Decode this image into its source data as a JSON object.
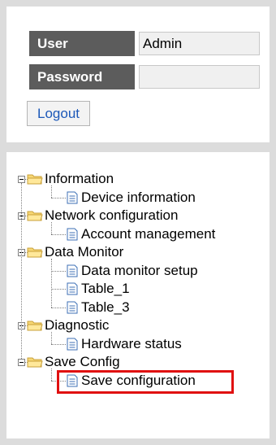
{
  "login": {
    "user_label": "User",
    "user_value": "Admin",
    "password_label": "Password",
    "password_value": "",
    "logout_label": "Logout"
  },
  "tree": {
    "groups": [
      {
        "label": "Information",
        "children": [
          "Device information"
        ]
      },
      {
        "label": "Network configuration",
        "children": [
          "Account management"
        ]
      },
      {
        "label": "Data Monitor",
        "children": [
          "Data monitor setup",
          "Table_1",
          "Table_3"
        ]
      },
      {
        "label": "Diagnostic",
        "children": [
          "Hardware status"
        ]
      },
      {
        "label": "Save Config",
        "children": [
          "Save configuration"
        ]
      }
    ],
    "highlighted_item": "Save configuration",
    "highlight_color": "#e01010"
  },
  "icons": {
    "expander": "minus-box-icon",
    "folder": "folder-open-icon",
    "document": "document-icon"
  }
}
